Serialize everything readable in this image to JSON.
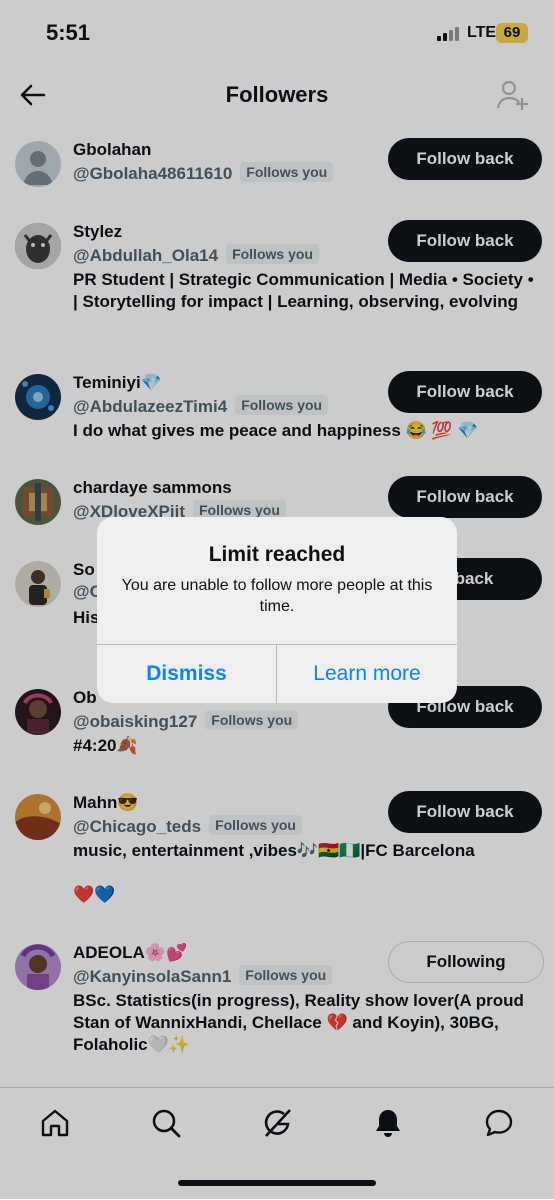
{
  "status_bar": {
    "time": "5:51",
    "network": "LTE",
    "battery": "69"
  },
  "header": {
    "title": "Followers",
    "back_icon": "arrow-left-icon",
    "add_user_icon": "add-user-icon"
  },
  "followers": [
    {
      "name": "Gbolahan",
      "handle": "@Gbolaha48611610",
      "follows_you": "Follows you",
      "bio": "",
      "button": "Follow back",
      "avatar_color": "#a9b4bd"
    },
    {
      "name": "Stylez",
      "handle": "@Abdullah_Ola14",
      "follows_you": "Follows you",
      "bio": "PR Student | Strategic Communication | Media • Society • | Storytelling for impact | Learning, observing, evolving",
      "button": "Follow back",
      "avatar_color": "#555"
    },
    {
      "name": "Teminiyi💎",
      "handle": "@AbdulazeezTimi4",
      "follows_you": "Follows you",
      "bio": "I do what gives me peace and happiness 😂 💯 💎",
      "button": "Follow back",
      "avatar_color": "#1f4f8a"
    },
    {
      "name": "chardaye sammons",
      "handle": "@XDloveXPiit",
      "follows_you": "Follows you",
      "bio": "",
      "button": "Follow back",
      "avatar_color": "#6d6a52"
    },
    {
      "name": "So",
      "handle": "@C",
      "follows_you": "",
      "bio": "His                                                    ndy Orton is t",
      "button": "w back",
      "avatar_color": "#9c8a7c"
    },
    {
      "name": "Ob",
      "handle": "@obaisking127",
      "follows_you": "Follows you",
      "bio": "#4:20🍂",
      "button": "Follow back",
      "avatar_color": "#6b2b3a"
    },
    {
      "name": "Mahn😎",
      "handle": "@Chicago_teds",
      "follows_you": "Follows you",
      "bio": "music, entertainment ,vibes🎶🇬🇭🇳🇬|FC Barcelona",
      "bio2": "❤️💙",
      "button": "Follow back",
      "avatar_color": "#b5652b"
    },
    {
      "name": "ADEOLA🌸💕",
      "handle": "@KanyinsolaSann1",
      "follows_you": "Follows you",
      "bio": "BSc. Statistics(in progress), Reality show lover(A proud Stan of WannixHandi, Chellace 💔 and Koyin), 30BG, Folaholic🤍✨",
      "button": "Following",
      "avatar_color": "#8c4fa7"
    }
  ],
  "dialog": {
    "title": "Limit reached",
    "message": "You are unable to follow more people at this time.",
    "dismiss": "Dismiss",
    "learn_more": "Learn more"
  },
  "tabbar": [
    "home-icon",
    "search-icon",
    "grok-icon",
    "notifications-icon",
    "messages-icon"
  ]
}
